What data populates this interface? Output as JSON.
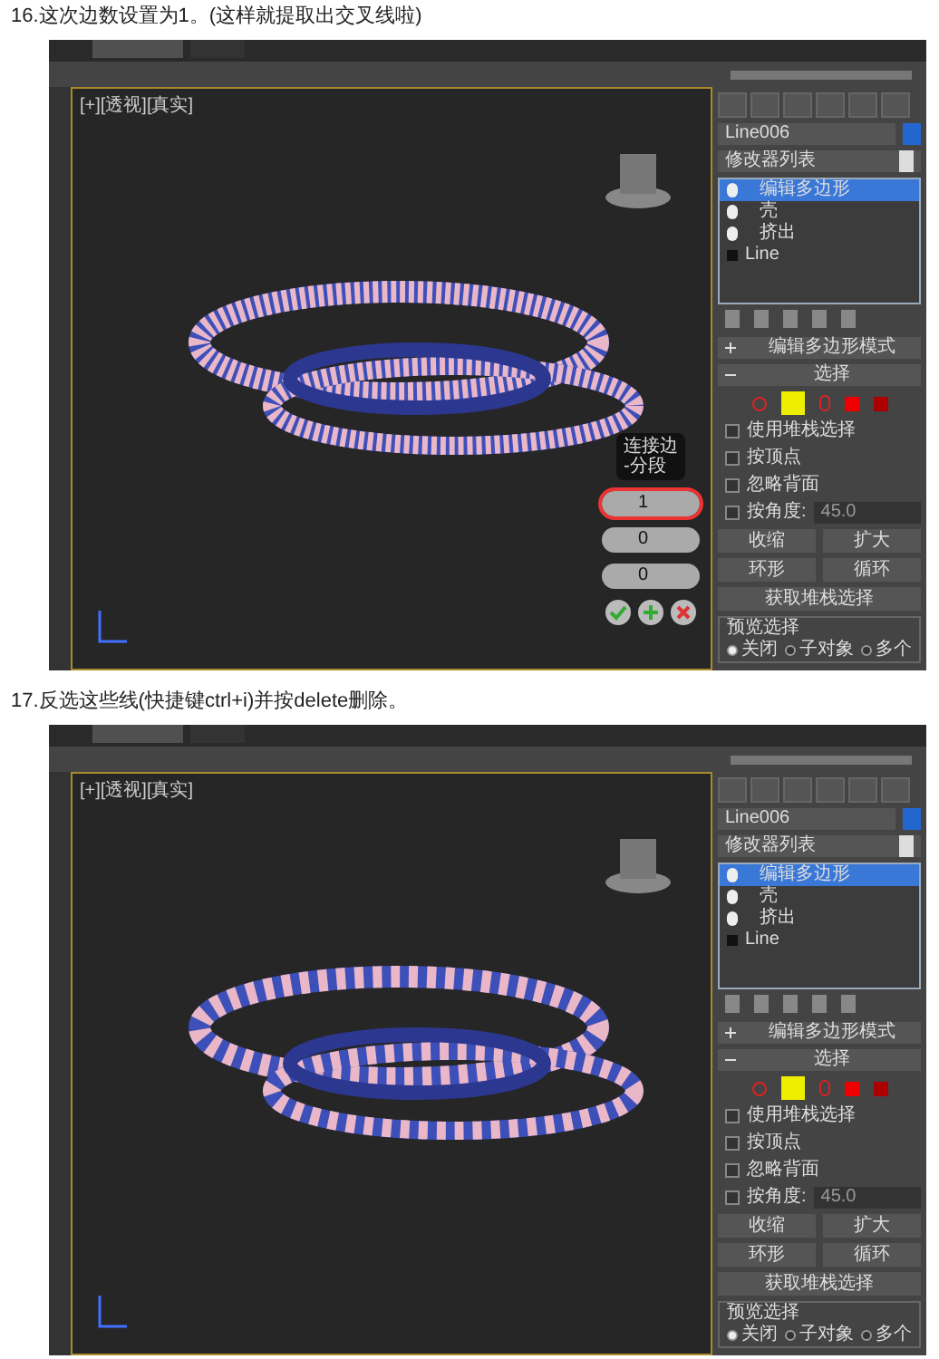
{
  "steps": [
    {
      "caption": "16.这次边数设置为1。(这样就提取出交叉线啦)",
      "screenshot": {
        "viewport_label": "[+][透视][真实]",
        "object_name": "Line006",
        "modifier_list": "修改器列表",
        "stack": [
          {
            "label": "编辑多边形",
            "kind": "modifier",
            "selected": true
          },
          {
            "label": "壳",
            "kind": "modifier",
            "selected": false
          },
          {
            "label": "挤出",
            "kind": "modifier",
            "selected": false
          },
          {
            "label": "Line",
            "kind": "base",
            "selected": false
          }
        ],
        "rollouts": [
          {
            "title": "编辑多边形模式",
            "expanded": false
          },
          {
            "title": "选择",
            "expanded": true
          }
        ],
        "checkboxes": [
          {
            "label": "使用堆栈选择",
            "checked": false
          },
          {
            "label": "按顶点",
            "checked": false
          },
          {
            "label": "忽略背面",
            "checked": false
          },
          {
            "label": "按角度:",
            "checked": false,
            "value": "45.0"
          }
        ],
        "buttons": [
          "收缩",
          "扩大"
        ],
        "spinner_buttons": [
          "环形",
          "循环"
        ],
        "get_button": "获取堆栈选择",
        "preview": {
          "title": "预览选择",
          "options": [
            {
              "label": "关闭",
              "selected": true
            },
            {
              "label": "子对象",
              "selected": false
            },
            {
              "label": "多个",
              "selected": false
            }
          ]
        },
        "caddy": {
          "title": "连接边\n-分段",
          "fields": [
            {
              "value": "1",
              "selected": true
            },
            {
              "value": "0",
              "selected": false
            },
            {
              "value": "0",
              "selected": false
            }
          ]
        }
      }
    },
    {
      "caption": "17.反选这些线(快捷键ctrl+i)并按delete删除。",
      "screenshot": {
        "viewport_label": "[+][透视][真实]",
        "object_name": "Line006",
        "modifier_list": "修改器列表",
        "stack": [
          {
            "label": "编辑多边形",
            "kind": "modifier",
            "selected": true
          },
          {
            "label": "壳",
            "kind": "modifier",
            "selected": false
          },
          {
            "label": "挤出",
            "kind": "modifier",
            "selected": false
          },
          {
            "label": "Line",
            "kind": "base",
            "selected": false
          }
        ],
        "rollouts": [
          {
            "title": "编辑多边形模式",
            "expanded": false
          },
          {
            "title": "选择",
            "expanded": true
          }
        ],
        "checkboxes": [
          {
            "label": "使用堆栈选择",
            "checked": false
          },
          {
            "label": "按顶点",
            "checked": false
          },
          {
            "label": "忽略背面",
            "checked": false
          },
          {
            "label": "按角度:",
            "checked": false,
            "value": "45.0"
          }
        ],
        "buttons": [
          "收缩",
          "扩大"
        ],
        "spinner_buttons": [
          "环形",
          "循环"
        ],
        "get_button": "获取堆栈选择",
        "preview": {
          "title": "预览选择",
          "options": [
            {
              "label": "关闭",
              "selected": true
            },
            {
              "label": "子对象",
              "selected": false
            },
            {
              "label": "多个",
              "selected": false
            }
          ]
        }
      }
    }
  ]
}
